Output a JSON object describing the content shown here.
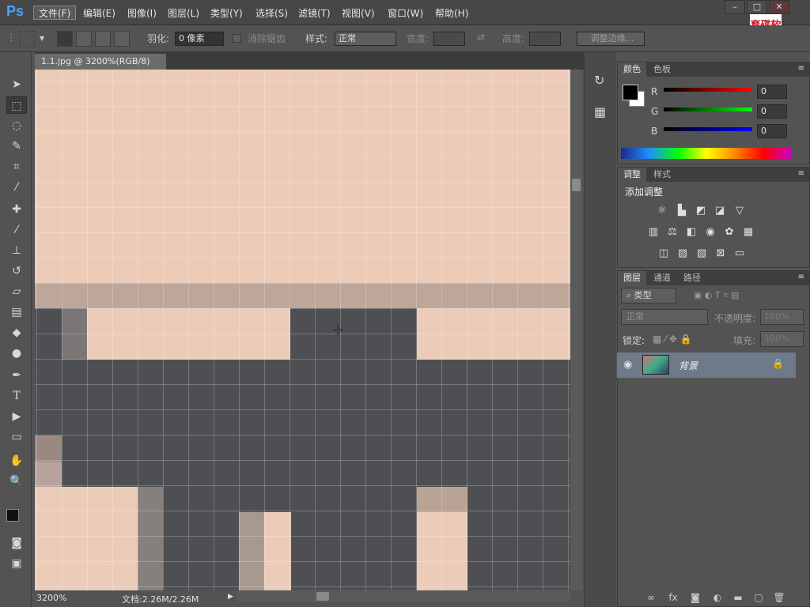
{
  "app": {
    "logo": "Ps"
  },
  "menu": [
    {
      "label": "文件(F)",
      "active": true
    },
    {
      "label": "编辑(E)"
    },
    {
      "label": "图像(I)"
    },
    {
      "label": "图层(L)"
    },
    {
      "label": "类型(Y)"
    },
    {
      "label": "选择(S)"
    },
    {
      "label": "滤镜(T)"
    },
    {
      "label": "视图(V)"
    },
    {
      "label": "窗口(W)"
    },
    {
      "label": "帮助(H)"
    }
  ],
  "watermark": "育碟软件",
  "options": {
    "feather_label": "羽化:",
    "feather_value": "0 像素",
    "antialias_label": "消除锯齿",
    "style_label": "样式:",
    "style_value": "正常",
    "width_label": "宽度:",
    "height_label": "高度:",
    "refine_edge": "调整边缘..."
  },
  "document": {
    "tab": "1.1.jpg @ 3200%(RGB/8)",
    "zoom": "3200%",
    "doc_size": "文档:2.26M/2.26M"
  },
  "colors": {
    "skin": "#ecccb8",
    "dark": "#4d4f52",
    "mid": "#bca79a"
  },
  "color_panel": {
    "tab_color": "颜色",
    "tab_swatches": "色板",
    "r_label": "R",
    "g_label": "G",
    "b_label": "B",
    "r": "0",
    "g": "0",
    "b": "0"
  },
  "adjust_panel": {
    "tab_adjust": "调整",
    "tab_styles": "样式",
    "title": "添加调整"
  },
  "layers_panel": {
    "tab_layers": "图层",
    "tab_channels": "通道",
    "tab_paths": "路径",
    "kind": "类型",
    "blend": "正常",
    "opacity_label": "不透明度:",
    "opacity": "100%",
    "lock_label": "锁定:",
    "fill_label": "填充:",
    "fill": "100%",
    "layer_name": "背景"
  }
}
